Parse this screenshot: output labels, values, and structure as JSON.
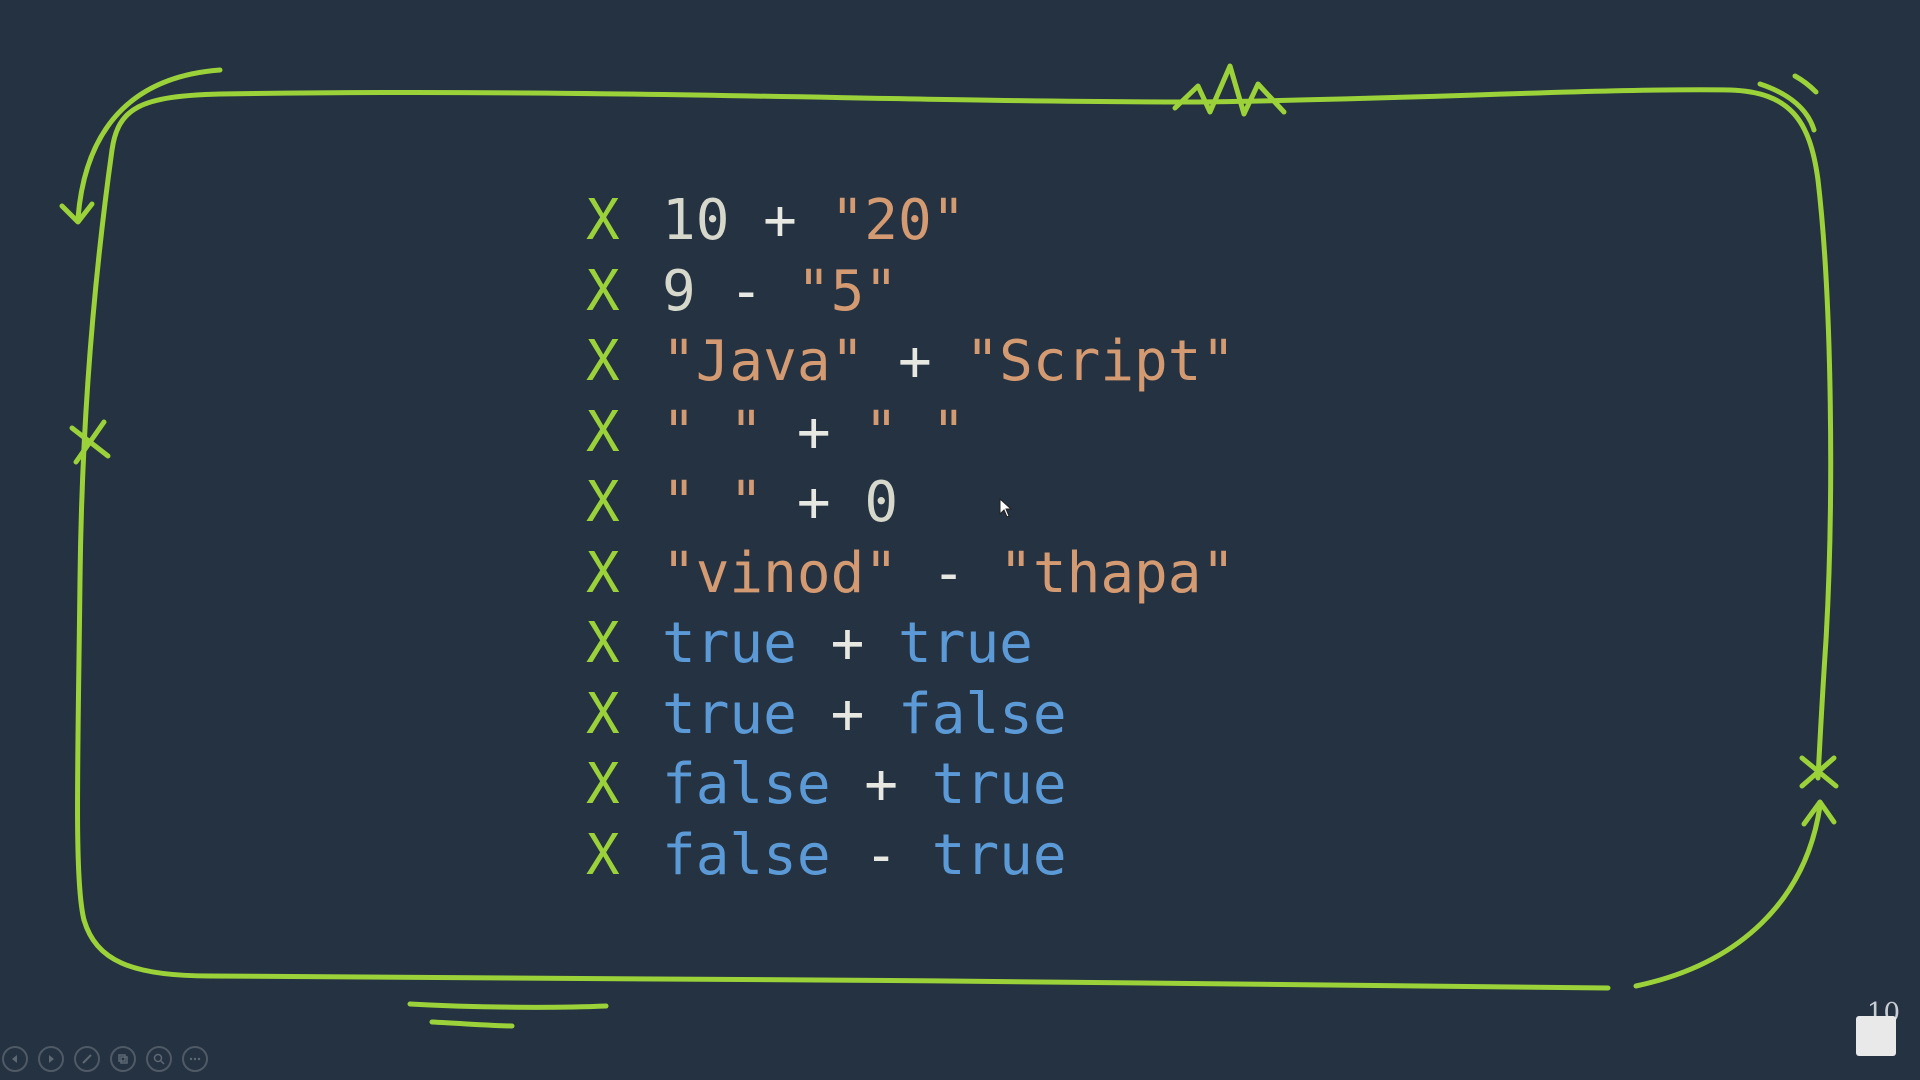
{
  "slide": {
    "number": "10",
    "lines": [
      {
        "mark": "X",
        "tokens": [
          {
            "text": "10",
            "kind": "num"
          },
          {
            "text": " + ",
            "kind": "op"
          },
          {
            "text": "\"20\"",
            "kind": "str"
          }
        ]
      },
      {
        "mark": "X",
        "tokens": [
          {
            "text": "9",
            "kind": "num"
          },
          {
            "text": " - ",
            "kind": "op"
          },
          {
            "text": "\"5\"",
            "kind": "str"
          }
        ]
      },
      {
        "mark": "X",
        "tokens": [
          {
            "text": "\"Java\"",
            "kind": "str"
          },
          {
            "text": " + ",
            "kind": "op"
          },
          {
            "text": "\"Script\"",
            "kind": "str"
          }
        ]
      },
      {
        "mark": "X",
        "tokens": [
          {
            "text": "\" \"",
            "kind": "str"
          },
          {
            "text": " + ",
            "kind": "op"
          },
          {
            "text": "\" \"",
            "kind": "str"
          }
        ]
      },
      {
        "mark": "X",
        "tokens": [
          {
            "text": "\" \"",
            "kind": "str"
          },
          {
            "text": " + ",
            "kind": "op"
          },
          {
            "text": "0",
            "kind": "num"
          }
        ]
      },
      {
        "mark": "X",
        "tokens": [
          {
            "text": "\"vinod\"",
            "kind": "str"
          },
          {
            "text": " - ",
            "kind": "op"
          },
          {
            "text": "\"thapa\"",
            "kind": "str"
          }
        ]
      },
      {
        "mark": "X",
        "tokens": [
          {
            "text": "true",
            "kind": "bool"
          },
          {
            "text": " + ",
            "kind": "op"
          },
          {
            "text": "true",
            "kind": "bool"
          }
        ]
      },
      {
        "mark": "X",
        "tokens": [
          {
            "text": "true",
            "kind": "bool"
          },
          {
            "text": " + ",
            "kind": "op"
          },
          {
            "text": "false",
            "kind": "bool"
          }
        ]
      },
      {
        "mark": "X",
        "tokens": [
          {
            "text": "false",
            "kind": "bool"
          },
          {
            "text": " + ",
            "kind": "op"
          },
          {
            "text": "true",
            "kind": "bool"
          }
        ]
      },
      {
        "mark": "X",
        "tokens": [
          {
            "text": "false",
            "kind": "bool"
          },
          {
            "text": " - ",
            "kind": "op"
          },
          {
            "text": "true",
            "kind": "bool"
          }
        ]
      }
    ]
  },
  "toolbar": {
    "buttons": [
      {
        "icon": "previous-icon"
      },
      {
        "icon": "next-icon"
      },
      {
        "icon": "pen-icon"
      },
      {
        "icon": "slides-icon"
      },
      {
        "icon": "zoom-icon"
      },
      {
        "icon": "more-icon"
      }
    ]
  },
  "colors": {
    "background": "#253241",
    "accent_green": "#9bd23a",
    "string": "#d49a72",
    "number": "#d6d8cc",
    "operator": "#e8e8e2",
    "boolean": "#5b9ad6"
  }
}
